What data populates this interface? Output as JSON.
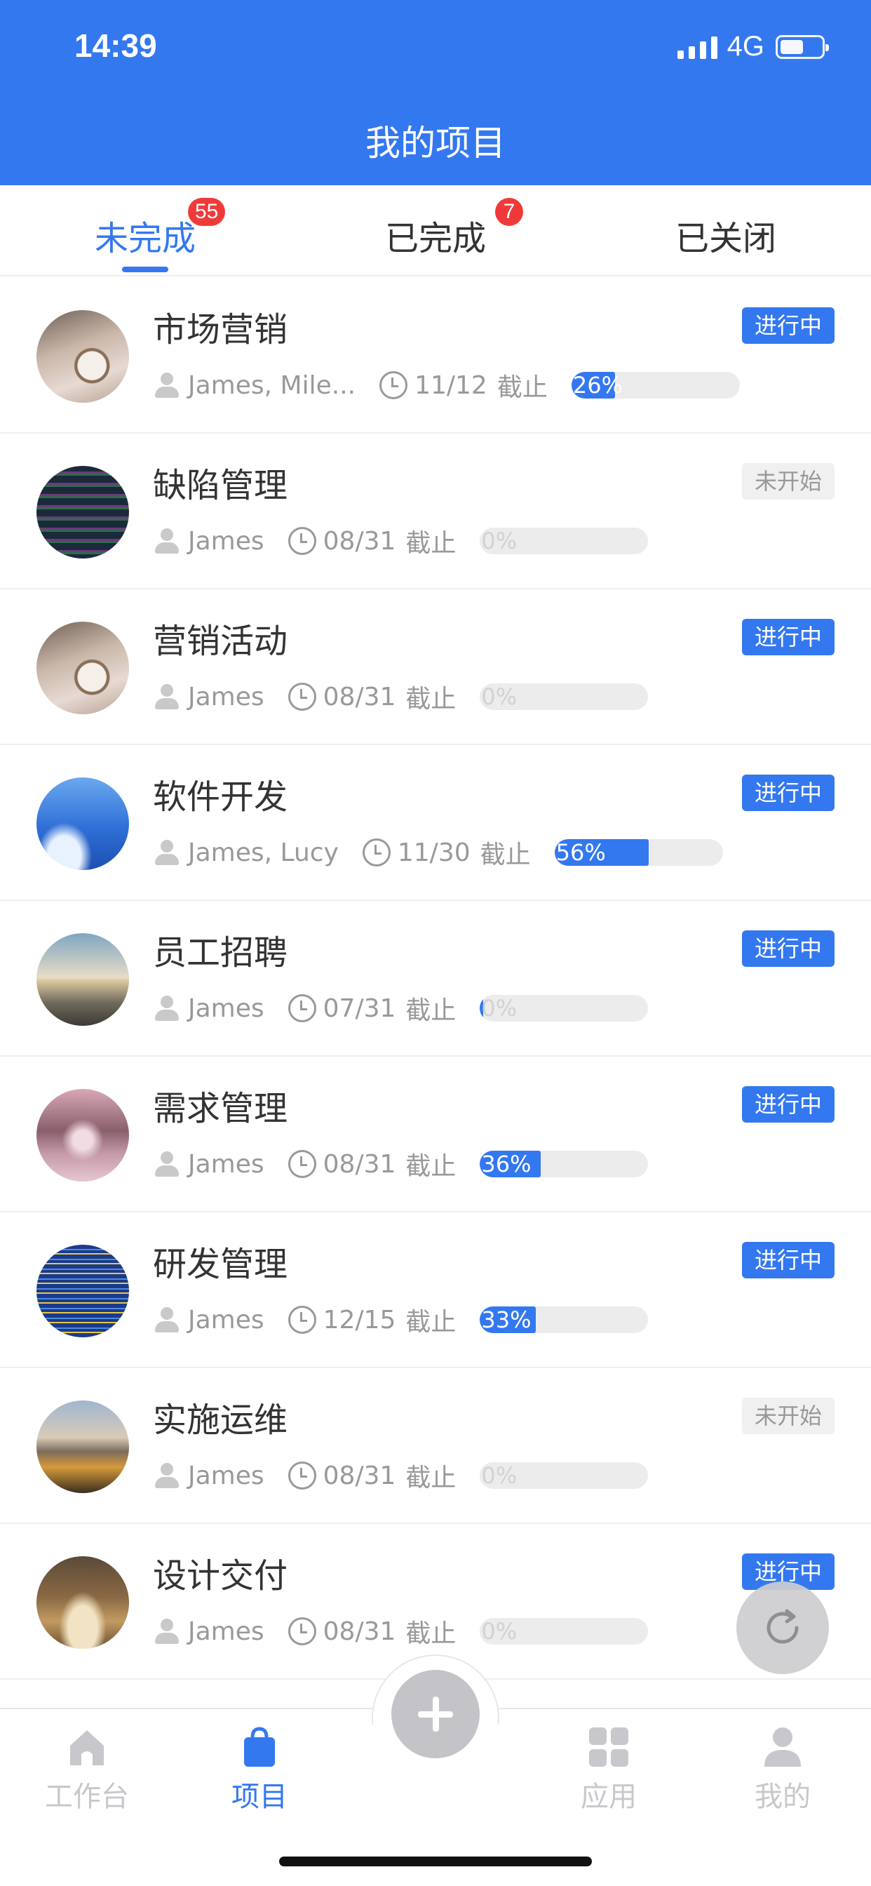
{
  "status_bar": {
    "time": "14:39",
    "network": "4G"
  },
  "header": {
    "title": "我的项目"
  },
  "tabs": [
    {
      "label": "未完成",
      "badge": "55",
      "active": true
    },
    {
      "label": "已完成",
      "badge": "7",
      "active": false
    },
    {
      "label": "已关闭",
      "badge": "",
      "active": false
    }
  ],
  "colors": {
    "primary": "#3478f0",
    "badge_red": "#f03a3a",
    "todo_tag_bg": "#f0f0f0",
    "muted_text": "#999999"
  },
  "projects": [
    {
      "title": "市场营销",
      "status": "进行中",
      "owners": "James, Mile...",
      "due_date": "11/12",
      "due_suffix": "截止",
      "progress": 26,
      "progress_label": "26%",
      "avatar": "eiffel-clock-image"
    },
    {
      "title": "缺陷管理",
      "status": "未开始",
      "owners": "James",
      "due_date": "08/31",
      "due_suffix": "截止",
      "progress": 0,
      "progress_label": "0%",
      "avatar": "code-screen-image"
    },
    {
      "title": "营销活动",
      "status": "进行中",
      "owners": "James",
      "due_date": "08/31",
      "due_suffix": "截止",
      "progress": 0,
      "progress_label": "0%",
      "avatar": "eiffel-clock-image"
    },
    {
      "title": "软件开发",
      "status": "进行中",
      "owners": "James, Lucy",
      "due_date": "11/30",
      "due_suffix": "截止",
      "progress": 56,
      "progress_label": "56%",
      "avatar": "blue-sky-image"
    },
    {
      "title": "员工招聘",
      "status": "进行中",
      "owners": "James",
      "due_date": "07/31",
      "due_suffix": "截止",
      "progress": 2,
      "progress_label": "0%",
      "avatar": "road-horizon-image"
    },
    {
      "title": "需求管理",
      "status": "进行中",
      "owners": "James",
      "due_date": "08/31",
      "due_suffix": "截止",
      "progress": 36,
      "progress_label": "36%",
      "avatar": "blossom-path-image"
    },
    {
      "title": "研发管理",
      "status": "进行中",
      "owners": "James",
      "due_date": "12/15",
      "due_suffix": "截止",
      "progress": 33,
      "progress_label": "33%",
      "avatar": "code-blue-image"
    },
    {
      "title": "实施运维",
      "status": "未开始",
      "owners": "James",
      "due_date": "08/31",
      "due_suffix": "截止",
      "progress": 0,
      "progress_label": "0%",
      "avatar": "lake-mountain-image"
    },
    {
      "title": "设计交付",
      "status": "进行中",
      "owners": "James",
      "due_date": "08/31",
      "due_suffix": "截止",
      "progress": 0,
      "progress_label": "0%",
      "avatar": "open-book-image"
    }
  ],
  "bottom_nav": [
    {
      "label": "工作台",
      "icon": "home-icon",
      "active": false
    },
    {
      "label": "项目",
      "icon": "bag-icon",
      "active": true
    },
    {
      "label": "",
      "icon": "plus-icon",
      "active": false
    },
    {
      "label": "应用",
      "icon": "grid-icon",
      "active": false
    },
    {
      "label": "我的",
      "icon": "person-icon",
      "active": false
    }
  ]
}
